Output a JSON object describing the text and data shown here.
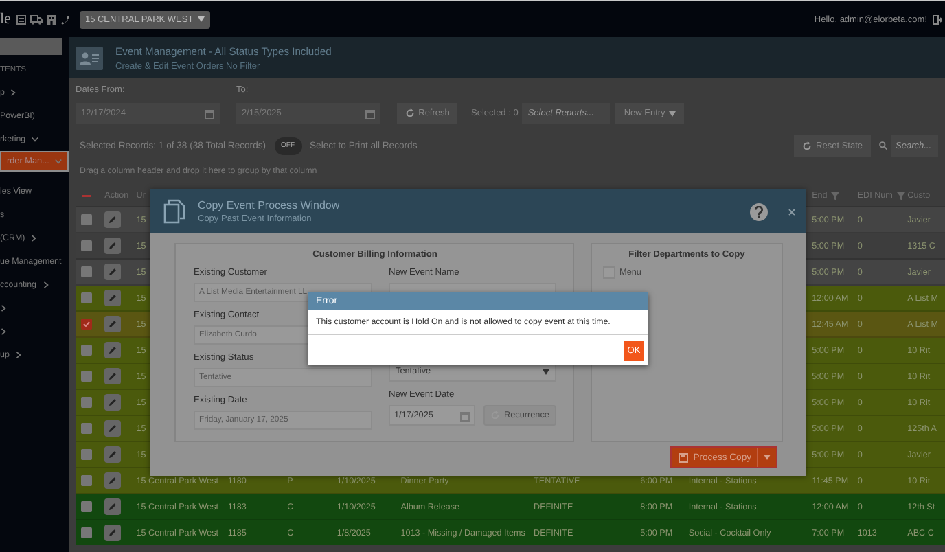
{
  "topbar": {
    "brand": "le",
    "location": "15 CENTRAL PARK WEST",
    "greeting": "Hello, admin@elorbeta.com!"
  },
  "sidebar": {
    "items": [
      {
        "label": "TENTS",
        "kind": "heading",
        "selected": false
      },
      {
        "label": "p",
        "kind": "group",
        "expanded": false,
        "selected": false
      },
      {
        "label": "PowerBI)",
        "kind": "link",
        "selected": false
      },
      {
        "label": "rketing",
        "kind": "group",
        "expanded": true,
        "selected": false
      },
      {
        "label": "rder Man...",
        "kind": "group",
        "expanded": true,
        "selected": true
      },
      {
        "label": "les View",
        "kind": "link",
        "selected": false
      },
      {
        "label": "s",
        "kind": "link",
        "selected": false
      },
      {
        "label": "(CRM)",
        "kind": "group",
        "expanded": false,
        "selected": false
      },
      {
        "label": "ue Management",
        "kind": "link",
        "selected": false
      },
      {
        "label": "ccounting",
        "kind": "group",
        "expanded": false,
        "selected": false
      },
      {
        "kind": "group",
        "expanded": false,
        "selected": false
      },
      {
        "kind": "group",
        "expanded": false,
        "selected": false
      },
      {
        "label": "up",
        "kind": "group",
        "expanded": false,
        "selected": false
      }
    ]
  },
  "header": {
    "title": "Event Management - All Status Types Included",
    "subtitle": "Create & Edit Event Orders No Filter"
  },
  "filters": {
    "from_label": "Dates From:",
    "from_value": "12/17/2024",
    "to_label": "To:",
    "to_value": "2/15/2025",
    "refresh": "Refresh",
    "selected_count": "Selected : 0",
    "reports_placeholder": "Select Reports...",
    "new_entry": "New Entry"
  },
  "records": {
    "summary": "Selected Records: 1 of 38 (38 Total Records)",
    "toggle": {
      "label": "OFF",
      "on": false
    },
    "print_label": "Select to Print all Records",
    "reset": "Reset State",
    "search_placeholder": "Search..."
  },
  "group_hint": "Drag a column header and drop it here to group by that column",
  "grid": {
    "header_checkbox": {
      "indeterminate": true
    },
    "columns": [
      {
        "label": "Action",
        "filter": false
      },
      {
        "label": "Ur",
        "filter": false
      },
      {
        "label": "End",
        "filter": true
      },
      {
        "label": "EDI Num",
        "filter": true
      },
      {
        "label": "Custo",
        "filter": false
      }
    ],
    "rows": [
      {
        "color": "#444444",
        "checked": false,
        "cells": {
          "ur": "15",
          "end": "5:00 PM",
          "edi": "0",
          "cust": "Javier"
        }
      },
      {
        "color": "#3d3d3d",
        "checked": false,
        "cells": {
          "ur": "15",
          "end": "5:00 PM",
          "edi": "0",
          "cust": "1315 C"
        }
      },
      {
        "color": "#444444",
        "checked": false,
        "cells": {
          "ur": "15",
          "end": "5:00 PM",
          "edi": "0",
          "cust": "Javier"
        }
      },
      {
        "color": "#4b5a0c",
        "checked": false,
        "cells": {
          "ur": "15",
          "end": "12:00 AM",
          "edi": "0",
          "cust": "A List M"
        }
      },
      {
        "color": "#5a5612",
        "checked": true,
        "cells": {
          "ur": "15",
          "end": "12:45 AM",
          "edi": "0",
          "cust": "A List M"
        }
      },
      {
        "color": "#4b5a0c",
        "checked": false,
        "cells": {
          "ur": "15",
          "end": "5:00 PM",
          "edi": "0",
          "cust": "10 Rit"
        }
      },
      {
        "color": "#4b5a0c",
        "checked": false,
        "cells": {
          "ur": "15",
          "end": "5:00 PM",
          "edi": "0",
          "cust": "10 Rit"
        }
      },
      {
        "color": "#4b5a0c",
        "checked": false,
        "cells": {
          "ur": "15",
          "end": "5:00 PM",
          "edi": "0",
          "cust": "10 Rit"
        }
      },
      {
        "color": "#4b5a0c",
        "checked": false,
        "cells": {
          "ur": "15",
          "end": "5:00 PM",
          "edi": "0",
          "cust": "125th A"
        }
      },
      {
        "color": "#4b5a0c",
        "checked": false,
        "cells": {
          "ur": "15",
          "end": "5:00 PM",
          "edi": "0",
          "cust": "Javier"
        }
      },
      {
        "color": "#4b5a0c",
        "checked": false,
        "cells": {
          "ur": "15 Central Park West",
          "column_4": "1180",
          "column_5": "P",
          "column_6": "1/10/2025",
          "column_7": "Dinner Party",
          "column_8": "TENTATIVE",
          "column_9": "6:00 PM",
          "column_10": "Internal - Stations",
          "end": "11:45 PM",
          "edi": "0",
          "cust": "10 Rit"
        }
      },
      {
        "color": "#12480f",
        "checked": false,
        "cells": {
          "ur": "15 Central Park West",
          "column_4": "1183",
          "column_5": "C",
          "column_6": "1/10/2025",
          "column_7": "Album Release",
          "column_8": "DEFINITE",
          "column_9": "8:00 PM",
          "column_10": "Internal - Stations",
          "end": "12:00 AM",
          "edi": "0",
          "cust": "12th St"
        }
      },
      {
        "color": "#12480f",
        "checked": false,
        "cells": {
          "ur": "15 Central Park West",
          "column_4": "1185",
          "column_5": "C",
          "column_6": "1/8/2025",
          "column_7": "1013 - Missing / Damaged Items",
          "column_8": "DEFINITE",
          "column_9": "5:00 PM",
          "column_10": "Social - Cocktail Only",
          "end": "7:00 PM",
          "edi": "1013",
          "cust": "ABC C"
        }
      }
    ]
  },
  "copy_window": {
    "title": "Copy Event Process Window",
    "subtitle": "Copy Past Event Information",
    "billing": {
      "heading": "Customer Billing Information",
      "existing": [
        {
          "label": "Existing Customer",
          "value": "A List Media Entertainment LL"
        },
        {
          "label": "Existing Contact",
          "value": "Elizabeth Curdo"
        },
        {
          "label": "Existing Status",
          "value": "Tentative"
        },
        {
          "label": "Existing Date",
          "value": "Friday, January 17, 2025"
        }
      ],
      "new_name_label": "New Event Name",
      "new_status": "Tentative",
      "new_date_label": "New Event Date",
      "new_date": "1/17/2025",
      "recurrence": "Recurrence"
    },
    "departments": {
      "heading": "Filter Departments to Copy",
      "items": [
        {
          "label": "Menu",
          "checked": false
        }
      ]
    },
    "process": "Process Copy"
  },
  "error": {
    "title": "Error",
    "message": "This customer account is Hold On and is not allowed to copy event at this time.",
    "ok": "OK"
  }
}
